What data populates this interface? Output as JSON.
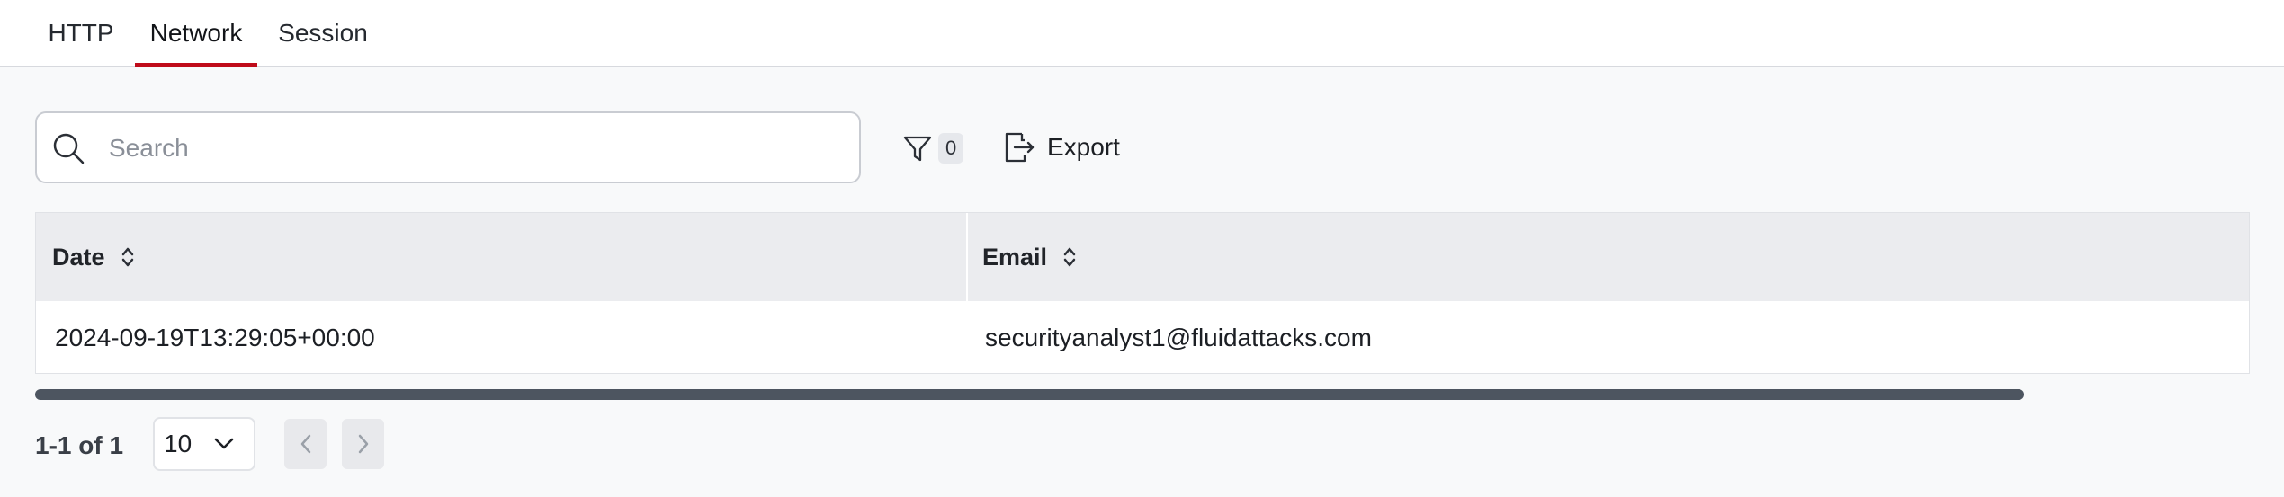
{
  "tabs": [
    {
      "label": "HTTP",
      "active": false
    },
    {
      "label": "Network",
      "active": true
    },
    {
      "label": "Session",
      "active": false
    }
  ],
  "search": {
    "placeholder": "Search",
    "value": ""
  },
  "filter": {
    "count": "0"
  },
  "export": {
    "label": "Export"
  },
  "table": {
    "columns": [
      "Date",
      "Email"
    ],
    "rows": [
      [
        "2024-09-19T13:29:05+00:00",
        "securityanalyst1@fluidattacks.com"
      ]
    ]
  },
  "pagination": {
    "info": "1-1 of 1",
    "page_size": "10"
  },
  "colors": {
    "accent": "#bf0b1a",
    "scrollbar": "#4d5560",
    "header_bg": "#ebecef"
  }
}
